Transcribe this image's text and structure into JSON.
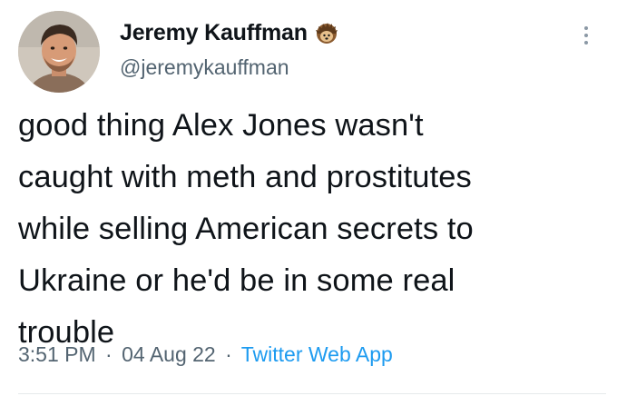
{
  "user": {
    "display_name": "Jeremy Kauffman",
    "handle": "@jeremykauffman",
    "badge_icon": "hedgehog-emoji-icon",
    "avatar_icon": "profile-photo-avatar"
  },
  "tweet": {
    "lines": [
      "good thing Alex Jones wasn't",
      "caught with meth and prostitutes",
      "while selling American secrets to",
      "Ukraine or he'd be in some real",
      "trouble"
    ]
  },
  "meta": {
    "time": "3:51 PM",
    "separator": "·",
    "date": "04 Aug 22",
    "source_app": "Twitter Web App"
  },
  "more_icon": "more-options-icon",
  "colors": {
    "text": "#0f1419",
    "secondary": "#536471",
    "link": "#1d9bf0"
  }
}
